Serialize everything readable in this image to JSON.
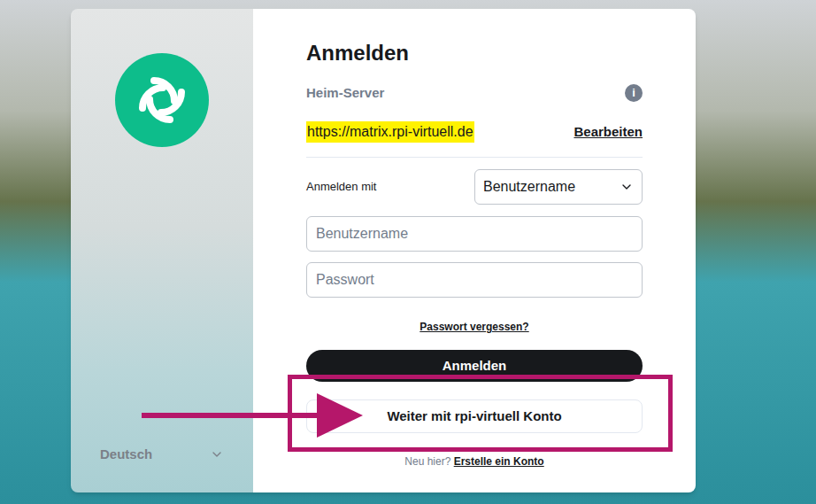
{
  "login": {
    "title": "Anmelden",
    "homeserver": {
      "label": "Heim-Server",
      "info_icon": "i",
      "url": "https://matrix.rpi-virtuell.de",
      "highlighted": true,
      "edit": "Bearbeiten"
    },
    "login_with": {
      "label": "Anmelden mit",
      "value": "Benutzername"
    },
    "fields": [
      {
        "placeholder": "Benutzername"
      },
      {
        "placeholder": "Passwort"
      }
    ],
    "forgot_password": "Passwort vergessen?",
    "submit": "Anmelden",
    "sso_button": {
      "label": "Weiter mit rpi-virtuell Konto",
      "highlighted": true
    },
    "register": {
      "prompt": "Neu hier?",
      "link": "Erstelle ein Konto"
    }
  },
  "language": "Deutsch"
}
